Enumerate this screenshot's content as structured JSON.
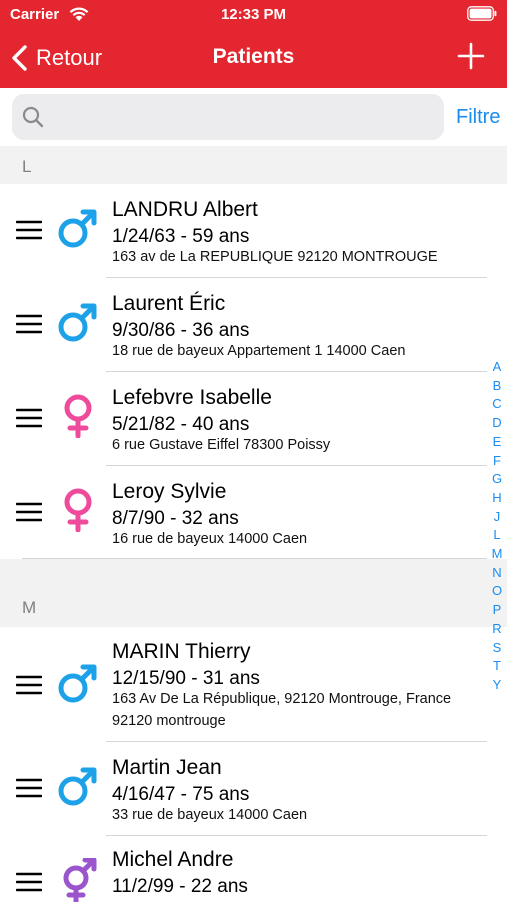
{
  "status": {
    "carrier": "Carrier",
    "time": "12:33 PM"
  },
  "nav": {
    "back_label": "Retour",
    "title": "Patients",
    "add_icon": "plus-icon"
  },
  "search": {
    "placeholder": "",
    "value": "",
    "filter_label": "Filtre"
  },
  "colors": {
    "brand": "#e3262f",
    "accent": "#1a8cf0",
    "male": "#1da1e8",
    "female": "#ef4b9c",
    "other": "#9b55cc"
  },
  "sections": [
    {
      "letter": "L",
      "patients": [
        {
          "name": "LANDRU Albert",
          "dob": "1/24/63 - 59 ans",
          "address": "163 av de La REPUBLIQUE 92120 MONTROUGE",
          "gender": "male"
        },
        {
          "name": "Laurent Éric",
          "dob": "9/30/86 - 36 ans",
          "address": "18 rue de bayeux Appartement 1 14000 Caen",
          "gender": "male"
        },
        {
          "name": "Lefebvre Isabelle",
          "dob": "5/21/82 - 40 ans",
          "address": "6 rue Gustave Eiffel 78300 Poissy",
          "gender": "female"
        },
        {
          "name": "Leroy Sylvie",
          "dob": "8/7/90 - 32 ans",
          "address": "16 rue de bayeux 14000 Caen",
          "gender": "female"
        }
      ]
    },
    {
      "letter": "M",
      "patients": [
        {
          "name": "MARIN Thierry",
          "dob": "12/15/90 - 31 ans",
          "address": "163 Av De La République, 92120 Montrouge, France 92120 montrouge",
          "gender": "male"
        },
        {
          "name": "Martin Jean",
          "dob": "4/16/47 - 75 ans",
          "address": "33 rue de bayeux 14000 Caen",
          "gender": "male"
        },
        {
          "name": "Michel Andre",
          "dob": "11/2/99 - 22 ans",
          "address": "",
          "gender": "other"
        }
      ]
    }
  ],
  "index_letters": [
    "A",
    "B",
    "C",
    "D",
    "E",
    "F",
    "G",
    "H",
    "J",
    "L",
    "M",
    "N",
    "O",
    "P",
    "R",
    "S",
    "T",
    "Y"
  ]
}
